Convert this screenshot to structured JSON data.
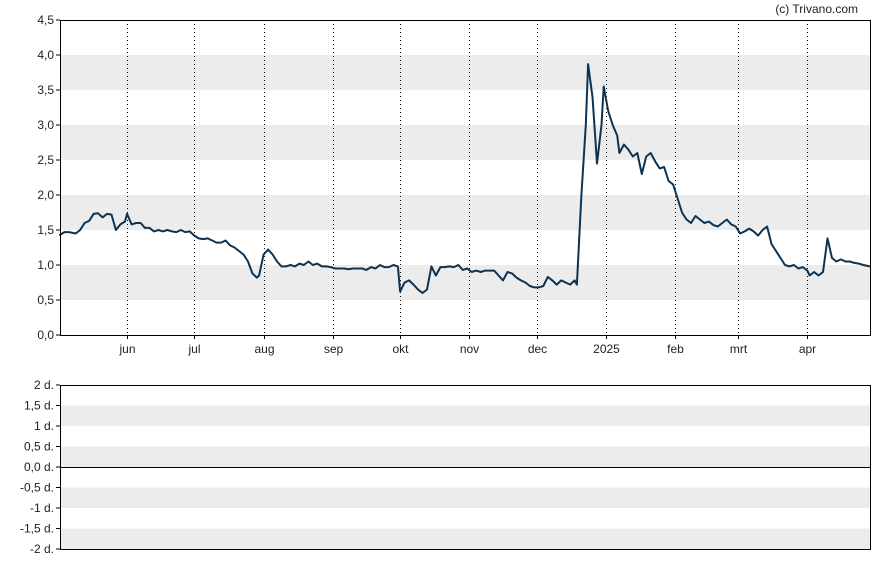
{
  "copyright": "(c) Trivano.com",
  "colors": {
    "line": "#0d3352",
    "band": "#ececec",
    "frame": "#000000",
    "grid": "#000000"
  },
  "chart_data": [
    {
      "type": "line",
      "title": "",
      "xlabel": "",
      "ylabel": "",
      "ylim": [
        0,
        4.5
      ],
      "grid": "vertical dotted at month ticks, alternating horizontal bands",
      "yticks": [
        "0,0",
        "0,5",
        "1,0",
        "1,5",
        "2,0",
        "2,5",
        "3,0",
        "3,5",
        "4,0",
        "4,5"
      ],
      "yvalues": [
        0,
        0.5,
        1.0,
        1.5,
        2.0,
        2.5,
        3.0,
        3.5,
        4.0,
        4.5
      ],
      "xticks": [
        {
          "label": "jun",
          "x": "2024-06-01"
        },
        {
          "label": "jul",
          "x": "2024-07-01"
        },
        {
          "label": "aug",
          "x": "2024-08-01"
        },
        {
          "label": "sep",
          "x": "2024-09-01"
        },
        {
          "label": "okt",
          "x": "2024-10-01"
        },
        {
          "label": "nov",
          "x": "2024-11-01"
        },
        {
          "label": "dec",
          "x": "2024-12-01"
        },
        {
          "label": "2025",
          "x": "2025-01-01"
        },
        {
          "label": "feb",
          "x": "2025-02-01"
        },
        {
          "label": "mrt",
          "x": "2025-03-01"
        },
        {
          "label": "apr",
          "x": "2025-04-01"
        }
      ],
      "xrange": [
        "2024-05-02",
        "2025-04-29"
      ],
      "series": [
        {
          "color": "#0d3352",
          "points": [
            [
              "2024-05-02",
              1.43
            ],
            [
              "2024-05-04",
              1.47
            ],
            [
              "2024-05-06",
              1.47
            ],
            [
              "2024-05-09",
              1.45
            ],
            [
              "2024-05-11",
              1.5
            ],
            [
              "2024-05-13",
              1.6
            ],
            [
              "2024-05-15",
              1.63
            ],
            [
              "2024-05-17",
              1.73
            ],
            [
              "2024-05-19",
              1.74
            ],
            [
              "2024-05-21",
              1.68
            ],
            [
              "2024-05-23",
              1.73
            ],
            [
              "2024-05-25",
              1.72
            ],
            [
              "2024-05-27",
              1.5
            ],
            [
              "2024-05-29",
              1.58
            ],
            [
              "2024-05-31",
              1.62
            ],
            [
              "2024-06-01",
              1.73
            ],
            [
              "2024-06-03",
              1.58
            ],
            [
              "2024-06-05",
              1.6
            ],
            [
              "2024-06-07",
              1.6
            ],
            [
              "2024-06-09",
              1.53
            ],
            [
              "2024-06-11",
              1.53
            ],
            [
              "2024-06-13",
              1.48
            ],
            [
              "2024-06-15",
              1.5
            ],
            [
              "2024-06-17",
              1.48
            ],
            [
              "2024-06-19",
              1.5
            ],
            [
              "2024-06-21",
              1.48
            ],
            [
              "2024-06-23",
              1.47
            ],
            [
              "2024-06-25",
              1.5
            ],
            [
              "2024-06-27",
              1.47
            ],
            [
              "2024-06-29",
              1.48
            ],
            [
              "2024-07-01",
              1.42
            ],
            [
              "2024-07-03",
              1.38
            ],
            [
              "2024-07-05",
              1.37
            ],
            [
              "2024-07-07",
              1.38
            ],
            [
              "2024-07-09",
              1.35
            ],
            [
              "2024-07-11",
              1.32
            ],
            [
              "2024-07-13",
              1.32
            ],
            [
              "2024-07-15",
              1.35
            ],
            [
              "2024-07-17",
              1.28
            ],
            [
              "2024-07-19",
              1.25
            ],
            [
              "2024-07-21",
              1.2
            ],
            [
              "2024-07-23",
              1.15
            ],
            [
              "2024-07-25",
              1.05
            ],
            [
              "2024-07-27",
              0.88
            ],
            [
              "2024-07-29",
              0.82
            ],
            [
              "2024-07-30",
              0.85
            ],
            [
              "2024-08-01",
              1.15
            ],
            [
              "2024-08-03",
              1.22
            ],
            [
              "2024-08-05",
              1.15
            ],
            [
              "2024-08-07",
              1.05
            ],
            [
              "2024-08-09",
              0.98
            ],
            [
              "2024-08-11",
              0.98
            ],
            [
              "2024-08-13",
              1.0
            ],
            [
              "2024-08-15",
              0.98
            ],
            [
              "2024-08-17",
              1.02
            ],
            [
              "2024-08-19",
              1.0
            ],
            [
              "2024-08-21",
              1.05
            ],
            [
              "2024-08-23",
              1.0
            ],
            [
              "2024-08-25",
              1.02
            ],
            [
              "2024-08-27",
              0.98
            ],
            [
              "2024-08-29",
              0.98
            ],
            [
              "2024-08-31",
              0.97
            ],
            [
              "2024-09-02",
              0.95
            ],
            [
              "2024-09-04",
              0.95
            ],
            [
              "2024-09-06",
              0.95
            ],
            [
              "2024-09-08",
              0.94
            ],
            [
              "2024-09-10",
              0.95
            ],
            [
              "2024-09-12",
              0.95
            ],
            [
              "2024-09-14",
              0.95
            ],
            [
              "2024-09-16",
              0.93
            ],
            [
              "2024-09-18",
              0.97
            ],
            [
              "2024-09-20",
              0.95
            ],
            [
              "2024-09-22",
              1.0
            ],
            [
              "2024-09-24",
              0.97
            ],
            [
              "2024-09-26",
              0.97
            ],
            [
              "2024-09-28",
              1.0
            ],
            [
              "2024-09-30",
              0.98
            ],
            [
              "2024-10-01",
              0.62
            ],
            [
              "2024-10-03",
              0.75
            ],
            [
              "2024-10-05",
              0.78
            ],
            [
              "2024-10-07",
              0.72
            ],
            [
              "2024-10-09",
              0.65
            ],
            [
              "2024-10-11",
              0.6
            ],
            [
              "2024-10-13",
              0.65
            ],
            [
              "2024-10-15",
              0.98
            ],
            [
              "2024-10-17",
              0.85
            ],
            [
              "2024-10-19",
              0.97
            ],
            [
              "2024-10-21",
              0.97
            ],
            [
              "2024-10-23",
              0.98
            ],
            [
              "2024-10-25",
              0.97
            ],
            [
              "2024-10-27",
              1.0
            ],
            [
              "2024-10-29",
              0.93
            ],
            [
              "2024-10-31",
              0.95
            ],
            [
              "2024-11-02",
              0.9
            ],
            [
              "2024-11-04",
              0.92
            ],
            [
              "2024-11-06",
              0.9
            ],
            [
              "2024-11-08",
              0.92
            ],
            [
              "2024-11-10",
              0.92
            ],
            [
              "2024-11-12",
              0.92
            ],
            [
              "2024-11-14",
              0.85
            ],
            [
              "2024-11-16",
              0.78
            ],
            [
              "2024-11-18",
              0.9
            ],
            [
              "2024-11-20",
              0.88
            ],
            [
              "2024-11-22",
              0.82
            ],
            [
              "2024-11-24",
              0.78
            ],
            [
              "2024-11-26",
              0.75
            ],
            [
              "2024-11-28",
              0.7
            ],
            [
              "2024-11-30",
              0.68
            ],
            [
              "2024-12-02",
              0.68
            ],
            [
              "2024-12-04",
              0.7
            ],
            [
              "2024-12-06",
              0.83
            ],
            [
              "2024-12-08",
              0.78
            ],
            [
              "2024-12-10",
              0.72
            ],
            [
              "2024-12-12",
              0.78
            ],
            [
              "2024-12-14",
              0.75
            ],
            [
              "2024-12-16",
              0.72
            ],
            [
              "2024-12-18",
              0.78
            ],
            [
              "2024-12-19",
              0.72
            ],
            [
              "2024-12-21",
              2.0
            ],
            [
              "2024-12-23",
              3.0
            ],
            [
              "2024-12-24",
              3.87
            ],
            [
              "2024-12-26",
              3.4
            ],
            [
              "2024-12-28",
              2.45
            ],
            [
              "2024-12-30",
              3.0
            ],
            [
              "2024-12-31",
              3.55
            ],
            [
              "2025-01-02",
              3.2
            ],
            [
              "2025-01-04",
              3.0
            ],
            [
              "2025-01-06",
              2.85
            ],
            [
              "2025-01-07",
              2.6
            ],
            [
              "2025-01-09",
              2.72
            ],
            [
              "2025-01-11",
              2.65
            ],
            [
              "2025-01-13",
              2.55
            ],
            [
              "2025-01-15",
              2.6
            ],
            [
              "2025-01-17",
              2.3
            ],
            [
              "2025-01-19",
              2.55
            ],
            [
              "2025-01-21",
              2.6
            ],
            [
              "2025-01-23",
              2.48
            ],
            [
              "2025-01-25",
              2.38
            ],
            [
              "2025-01-27",
              2.4
            ],
            [
              "2025-01-29",
              2.2
            ],
            [
              "2025-01-31",
              2.15
            ],
            [
              "2025-02-02",
              1.95
            ],
            [
              "2025-02-04",
              1.75
            ],
            [
              "2025-02-06",
              1.65
            ],
            [
              "2025-02-08",
              1.6
            ],
            [
              "2025-02-10",
              1.7
            ],
            [
              "2025-02-12",
              1.65
            ],
            [
              "2025-02-14",
              1.6
            ],
            [
              "2025-02-16",
              1.62
            ],
            [
              "2025-02-18",
              1.57
            ],
            [
              "2025-02-20",
              1.55
            ],
            [
              "2025-02-22",
              1.6
            ],
            [
              "2025-02-24",
              1.65
            ],
            [
              "2025-02-26",
              1.58
            ],
            [
              "2025-02-28",
              1.55
            ],
            [
              "2025-03-02",
              1.45
            ],
            [
              "2025-03-04",
              1.48
            ],
            [
              "2025-03-06",
              1.52
            ],
            [
              "2025-03-08",
              1.48
            ],
            [
              "2025-03-10",
              1.42
            ],
            [
              "2025-03-12",
              1.5
            ],
            [
              "2025-03-14",
              1.55
            ],
            [
              "2025-03-16",
              1.3
            ],
            [
              "2025-03-18",
              1.2
            ],
            [
              "2025-03-20",
              1.1
            ],
            [
              "2025-03-22",
              1.0
            ],
            [
              "2025-03-24",
              0.98
            ],
            [
              "2025-03-26",
              1.0
            ],
            [
              "2025-03-28",
              0.95
            ],
            [
              "2025-03-30",
              0.97
            ],
            [
              "2025-04-01",
              0.92
            ],
            [
              "2025-04-02",
              0.85
            ],
            [
              "2025-04-04",
              0.9
            ],
            [
              "2025-04-06",
              0.85
            ],
            [
              "2025-04-08",
              0.9
            ],
            [
              "2025-04-10",
              1.38
            ],
            [
              "2025-04-12",
              1.1
            ],
            [
              "2025-04-14",
              1.05
            ],
            [
              "2025-04-16",
              1.08
            ],
            [
              "2025-04-18",
              1.05
            ],
            [
              "2025-04-20",
              1.05
            ],
            [
              "2025-04-22",
              1.03
            ],
            [
              "2025-04-24",
              1.02
            ],
            [
              "2025-04-26",
              1.0
            ],
            [
              "2025-04-29",
              0.98
            ]
          ]
        }
      ]
    },
    {
      "type": "line",
      "title": "",
      "xlabel": "",
      "ylabel": "",
      "ylim": [
        -2,
        2
      ],
      "grid": "horizontal bands, zero line",
      "yticks": [
        "2 d.",
        "1,5 d.",
        "1 d.",
        "0,5 d.",
        "0,0 d.",
        "-0,5 d.",
        "-1 d.",
        "-1,5 d.",
        "-2 d."
      ],
      "yvalues": [
        2,
        1.5,
        1,
        0.5,
        0,
        -0.5,
        -1,
        -1.5,
        -2
      ],
      "series": []
    }
  ]
}
